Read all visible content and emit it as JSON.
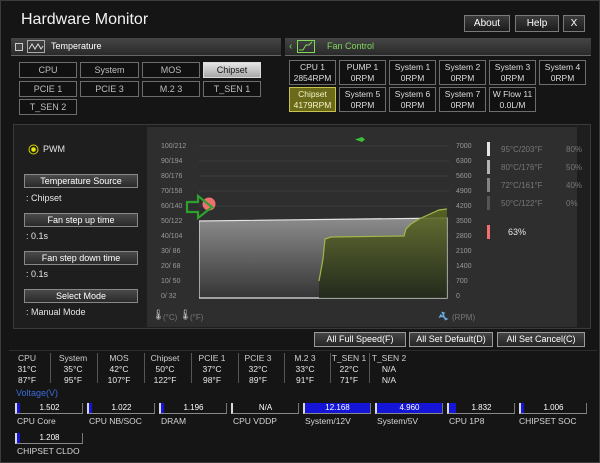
{
  "window": {
    "title": "Hardware Monitor",
    "buttons": [
      "About",
      "Help",
      "X"
    ]
  },
  "temperature": {
    "header": "Temperature",
    "sensors": [
      "CPU",
      "System",
      "MOS",
      "Chipset",
      "PCIE 1",
      "PCIE 3",
      "M.2 3",
      "T_SEN 1",
      "T_SEN 2"
    ],
    "selected": "Chipset"
  },
  "fan_control": {
    "header": "Fan Control",
    "fans": [
      {
        "name": "CPU 1",
        "value": "2854RPM"
      },
      {
        "name": "PUMP 1",
        "value": "0RPM"
      },
      {
        "name": "System 1",
        "value": "0RPM"
      },
      {
        "name": "System 2",
        "value": "0RPM"
      },
      {
        "name": "System 3",
        "value": "0RPM"
      },
      {
        "name": "System 4",
        "value": "0RPM"
      },
      {
        "name": "Chipset",
        "value": "4179RPM"
      },
      {
        "name": "System 5",
        "value": "0RPM"
      },
      {
        "name": "System 6",
        "value": "0RPM"
      },
      {
        "name": "System 7",
        "value": "0RPM"
      },
      {
        "name": "W Flow 11",
        "value": "0.0L/M"
      }
    ],
    "selected": "Chipset"
  },
  "settings": {
    "mode_label": "PWM",
    "temp_source_label": "Temperature Source",
    "temp_source_value": ": Chipset",
    "step_up_label": "Fan step up time",
    "step_up_value": ": 0.1s",
    "step_down_label": "Fan step down time",
    "step_down_value": ": 0.1s",
    "select_mode_label": "Select Mode",
    "select_mode_value": ": Manual Mode"
  },
  "graph": {
    "temp_ticks": [
      "100/212",
      "90/194",
      "80/176",
      "70/158",
      "60/140",
      "50/122",
      "40/104",
      "30/ 86",
      "20/ 68",
      "10/ 50",
      "0/ 32"
    ],
    "rpm_ticks": [
      "7000",
      "6300",
      "5600",
      "4900",
      "4200",
      "3500",
      "2800",
      "2100",
      "1400",
      "700",
      "0"
    ],
    "unit_c": "(°C)",
    "unit_f": "(°F)",
    "unit_rpm": "(RPM)"
  },
  "legend": {
    "rows": [
      {
        "temp": "95°C/203°F",
        "pct": "80%"
      },
      {
        "temp": "80°C/176°F",
        "pct": "50%"
      },
      {
        "temp": "72°C/161°F",
        "pct": "40%"
      },
      {
        "temp": "50°C/122°F",
        "pct": "0%"
      }
    ],
    "current_pct": "63%"
  },
  "actions": {
    "full_speed": "All Full Speed(F)",
    "set_default": "All Set Default(D)",
    "set_cancel": "All Set Cancel(C)"
  },
  "summary": [
    {
      "name": "CPU",
      "c": "31°C",
      "f": "87°F"
    },
    {
      "name": "System",
      "c": "35°C",
      "f": "95°F"
    },
    {
      "name": "MOS",
      "c": "42°C",
      "f": "107°F"
    },
    {
      "name": "Chipset",
      "c": "50°C",
      "f": "122°F"
    },
    {
      "name": "PCIE 1",
      "c": "37°C",
      "f": "98°F"
    },
    {
      "name": "PCIE 3",
      "c": "32°C",
      "f": "89°F"
    },
    {
      "name": "M.2 3",
      "c": "33°C",
      "f": "91°F"
    },
    {
      "name": "T_SEN 1",
      "c": "22°C",
      "f": "71°F"
    },
    {
      "name": "T_SEN 2",
      "c": "N/A",
      "f": "N/A"
    }
  ],
  "voltage": {
    "header": "Voltage(V)",
    "items": [
      {
        "name": "CPU Core",
        "value": "1.502",
        "fill": 0.05
      },
      {
        "name": "CPU NB/SOC",
        "value": "1.022",
        "fill": 0.05
      },
      {
        "name": "DRAM",
        "value": "1.196",
        "fill": 0.05
      },
      {
        "name": "CPU VDDP",
        "value": "N/A",
        "fill": 0
      },
      {
        "name": "System/12V",
        "value": "12.168",
        "fill": 1.0
      },
      {
        "name": "System/5V",
        "value": "4.960",
        "fill": 1.0
      },
      {
        "name": "CPU 1P8",
        "value": "1.832",
        "fill": 0.1
      },
      {
        "name": "CHIPSET SOC",
        "value": "1.006",
        "fill": 0.05
      },
      {
        "name": "CHIPSET CLDO",
        "value": "1.208",
        "fill": 0.05
      }
    ]
  },
  "colors": {
    "accent_green": "#7fd858",
    "selected_fan": "#6b6a1a",
    "voltage_fill": "#1515d8",
    "voltage_header": "#3a6cd8",
    "marker_red": "#f07070"
  }
}
